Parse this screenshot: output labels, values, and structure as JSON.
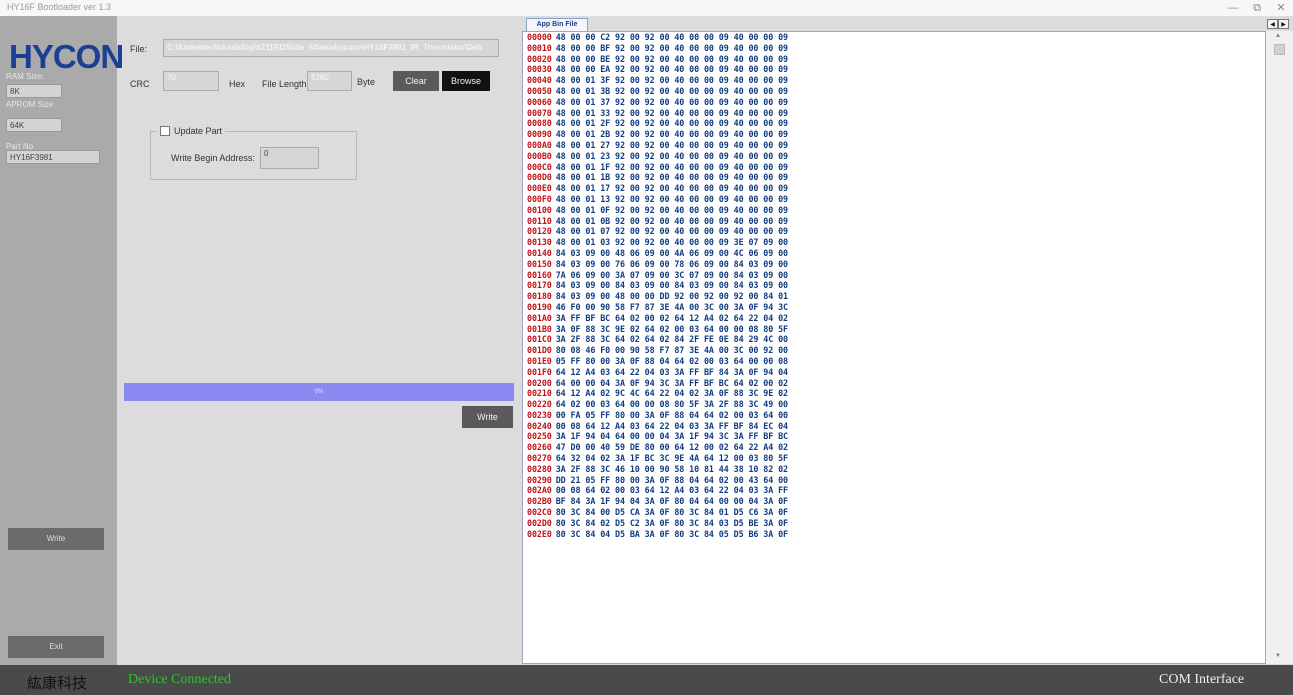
{
  "window": {
    "title": "HY16F Bootloader ver 1.3",
    "controls": [
      "—",
      "⧉",
      "✕"
    ]
  },
  "sidebar": {
    "logo": "HYCON",
    "ram_label": "RAM Size:",
    "ram_value": "8K",
    "aprom_label": "APROM Size:",
    "aprom_value": "64K",
    "part_label": "Part No",
    "part_value": "HY16F3981",
    "write_button": "Write",
    "exit_button": "Exit"
  },
  "form": {
    "file_label": "File:",
    "file_path": "C:\\Andestech\\AndeSight211RDS\\ide_64\\workspace\\HY16F3981_IR_Thermistor\\Deb",
    "crc_label": "CRC",
    "crc_value": "70",
    "crc_unit": "Hex",
    "length_label": "File Length:",
    "length_value": "6280",
    "length_unit": "Byte",
    "clear_button": "Clear",
    "browse_button": "Browse",
    "update_part_label": "Update Part",
    "update_part_checked": false,
    "write_begin_label": "Write Begin Address:",
    "write_begin_value": "0",
    "progress_text": "0%",
    "progress_value": 0,
    "write_button": "Write"
  },
  "hexview": {
    "tab_label": "App Bin File",
    "rows": [
      {
        "addr": "00000",
        "bytes": "48 00 00 C2 92 00 92 00 40 00 00 09 40 00 00 09"
      },
      {
        "addr": "00010",
        "bytes": "48 00 00 BF 92 00 92 00 40 00 00 09 40 00 00 09"
      },
      {
        "addr": "00020",
        "bytes": "48 00 00 BE 92 00 92 00 40 00 00 09 40 00 00 09"
      },
      {
        "addr": "00030",
        "bytes": "48 00 00 EA 92 00 92 00 40 00 00 09 40 00 00 09"
      },
      {
        "addr": "00040",
        "bytes": "48 00 01 3F 92 00 92 00 40 00 00 09 40 00 00 09"
      },
      {
        "addr": "00050",
        "bytes": "48 00 01 3B 92 00 92 00 40 00 00 09 40 00 00 09"
      },
      {
        "addr": "00060",
        "bytes": "48 00 01 37 92 00 92 00 40 00 00 09 40 00 00 09"
      },
      {
        "addr": "00070",
        "bytes": "48 00 01 33 92 00 92 00 40 00 00 09 40 00 00 09"
      },
      {
        "addr": "00080",
        "bytes": "48 00 01 2F 92 00 92 00 40 00 00 09 40 00 00 09"
      },
      {
        "addr": "00090",
        "bytes": "48 00 01 2B 92 00 92 00 40 00 00 09 40 00 00 09"
      },
      {
        "addr": "000A0",
        "bytes": "48 00 01 27 92 00 92 00 40 00 00 09 40 00 00 09"
      },
      {
        "addr": "000B0",
        "bytes": "48 00 01 23 92 00 92 00 40 00 00 09 40 00 00 09"
      },
      {
        "addr": "000C0",
        "bytes": "48 00 01 1F 92 00 92 00 40 00 00 09 40 00 00 09"
      },
      {
        "addr": "000D0",
        "bytes": "48 00 01 1B 92 00 92 00 40 00 00 09 40 00 00 09"
      },
      {
        "addr": "000E0",
        "bytes": "48 00 01 17 92 00 92 00 40 00 00 09 40 00 00 09"
      },
      {
        "addr": "000F0",
        "bytes": "48 00 01 13 92 00 92 00 40 00 00 09 40 00 00 09"
      },
      {
        "addr": "00100",
        "bytes": "48 00 01 0F 92 00 92 00 40 00 00 09 40 00 00 09"
      },
      {
        "addr": "00110",
        "bytes": "48 00 01 0B 92 00 92 00 40 00 00 09 40 00 00 09"
      },
      {
        "addr": "00120",
        "bytes": "48 00 01 07 92 00 92 00 40 00 00 09 40 00 00 09"
      },
      {
        "addr": "00130",
        "bytes": "48 00 01 03 92 00 92 00 40 00 00 09 3E 07 09 00"
      },
      {
        "addr": "00140",
        "bytes": "84 03 09 00 48 06 09 00 4A 06 09 00 4C 06 09 00"
      },
      {
        "addr": "00150",
        "bytes": "84 03 09 00 76 06 09 00 78 06 09 00 84 03 09 00"
      },
      {
        "addr": "00160",
        "bytes": "7A 06 09 00 3A 07 09 00 3C 07 09 00 84 03 09 00"
      },
      {
        "addr": "00170",
        "bytes": "84 03 09 00 84 03 09 00 84 03 09 00 84 03 09 00"
      },
      {
        "addr": "00180",
        "bytes": "84 03 09 00 48 00 00 DD 92 00 92 00 92 00 84 01"
      },
      {
        "addr": "00190",
        "bytes": "46 F0 00 90 58 F7 87 3E 4A 00 3C 00 3A 0F 94 3C"
      },
      {
        "addr": "001A0",
        "bytes": "3A FF BF BC 64 02 00 02 64 12 A4 02 64 22 04 02"
      },
      {
        "addr": "001B0",
        "bytes": "3A 0F 88 3C 9E 02 64 02 00 03 64 00 00 08 80 5F"
      },
      {
        "addr": "001C0",
        "bytes": "3A 2F 88 3C 64 02 64 02 84 2F FE 0E 84 29 4C 00"
      },
      {
        "addr": "001D0",
        "bytes": "80 08 46 F0 00 90 58 F7 87 3E 4A 00 3C 00 92 00"
      },
      {
        "addr": "001E0",
        "bytes": "05 FF 80 00 3A 0F 88 04 64 02 00 03 64 00 00 08"
      },
      {
        "addr": "001F0",
        "bytes": "64 12 A4 03 64 22 04 03 3A FF BF 84 3A 0F 94 04"
      },
      {
        "addr": "00200",
        "bytes": "64 00 00 04 3A 0F 94 3C 3A FF BF BC 64 02 00 02"
      },
      {
        "addr": "00210",
        "bytes": "64 12 A4 02 9C 4C 64 22 04 02 3A 0F 88 3C 9E 02"
      },
      {
        "addr": "00220",
        "bytes": "64 02 00 03 64 00 00 08 80 5F 3A 2F 88 3C 49 00"
      },
      {
        "addr": "00230",
        "bytes": "00 FA 05 FF 80 00 3A 0F 88 04 64 02 00 03 64 00"
      },
      {
        "addr": "00240",
        "bytes": "00 08 64 12 A4 03 64 22 04 03 3A FF BF 84 EC 04"
      },
      {
        "addr": "00250",
        "bytes": "3A 1F 94 04 64 00 00 04 3A 1F 94 3C 3A FF BF BC"
      },
      {
        "addr": "00260",
        "bytes": "47 D0 00 40 59 DE 80 00 64 12 00 02 64 22 A4 02"
      },
      {
        "addr": "00270",
        "bytes": "64 32 04 02 3A 1F BC 3C 9E 4A 64 12 00 03 80 5F"
      },
      {
        "addr": "00280",
        "bytes": "3A 2F 88 3C 46 10 00 90 58 10 81 44 38 10 82 02"
      },
      {
        "addr": "00290",
        "bytes": "DD 21 05 FF 80 00 3A 0F 88 04 64 02 00 43 64 00"
      },
      {
        "addr": "002A0",
        "bytes": "00 08 64 02 00 03 64 12 A4 03 64 22 04 03 3A FF"
      },
      {
        "addr": "002B0",
        "bytes": "BF 84 3A 1F 94 04 3A 0F 80 04 64 00 00 04 3A 0F"
      },
      {
        "addr": "002C0",
        "bytes": "80 3C 84 00 D5 CA 3A 0F 80 3C 84 01 D5 C6 3A 0F"
      },
      {
        "addr": "002D0",
        "bytes": "80 3C 84 02 D5 C2 3A 0F 80 3C 84 03 D5 BE 3A 0F"
      },
      {
        "addr": "002E0",
        "bytes": "80 3C 84 04 D5 BA 3A 0F 80 3C 84 05 D5 B6 3A 0F"
      }
    ]
  },
  "status": {
    "company": "紘康科技",
    "device_status": "Device Connected",
    "interface": "COM Interface"
  }
}
